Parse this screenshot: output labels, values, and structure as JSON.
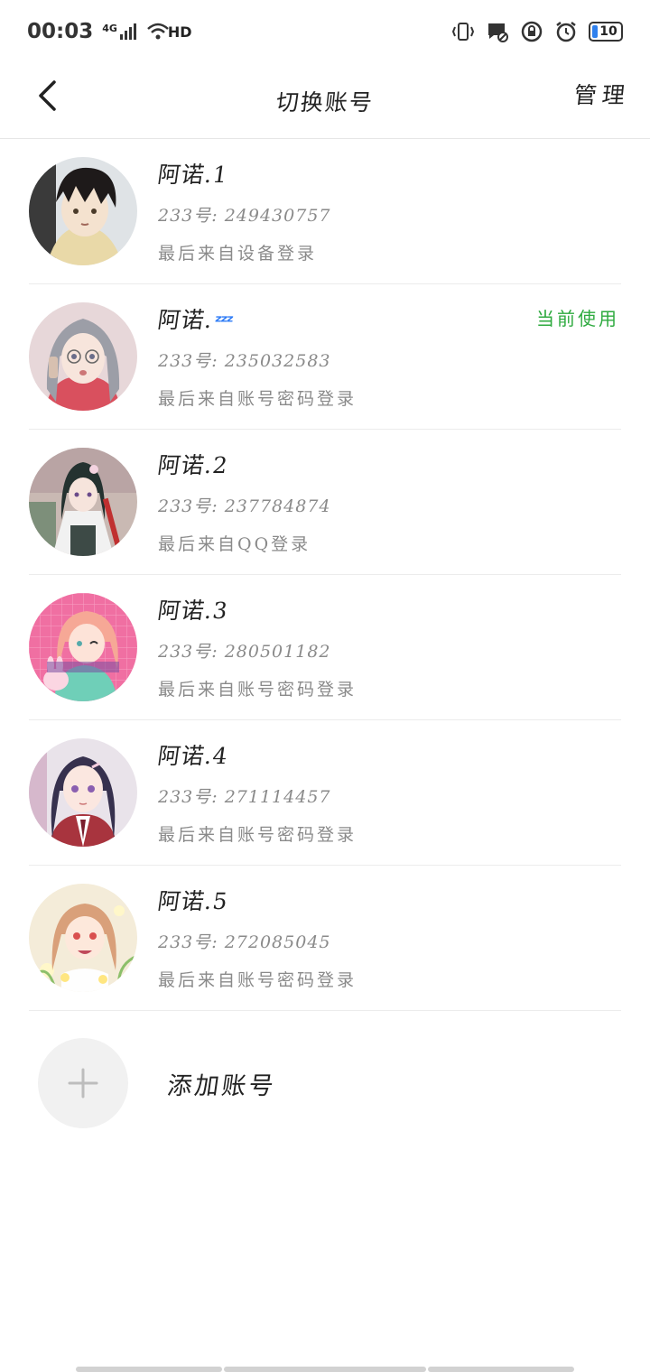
{
  "status_bar": {
    "time": "00:03",
    "network": "4G",
    "wifi_badge": "HD",
    "battery": "10"
  },
  "nav": {
    "title": "切换账号",
    "manage": "管理"
  },
  "accounts": [
    {
      "name": "阿诺.1",
      "number": "233号: 249430757",
      "login": "最后来自设备登录",
      "current": ""
    },
    {
      "name": "阿诺.",
      "emoji": "ᶻᶻᶻ",
      "number": "233号: 235032583",
      "login": "最后来自账号密码登录",
      "current": "当前使用"
    },
    {
      "name": "阿诺.2",
      "number": "233号: 237784874",
      "login": "最后来自QQ登录",
      "current": ""
    },
    {
      "name": "阿诺.3",
      "number": "233号: 280501182",
      "login": "最后来自账号密码登录",
      "current": ""
    },
    {
      "name": "阿诺.4",
      "number": "233号: 271114457",
      "login": "最后来自账号密码登录",
      "current": ""
    },
    {
      "name": "阿诺.5",
      "number": "233号: 272085045",
      "login": "最后来自账号密码登录",
      "current": ""
    }
  ],
  "add_account": {
    "label": "添加账号"
  },
  "colors": {
    "current_green": "#2eaa3f",
    "secondary_text": "#8a8a8a",
    "divider": "#ececec"
  }
}
